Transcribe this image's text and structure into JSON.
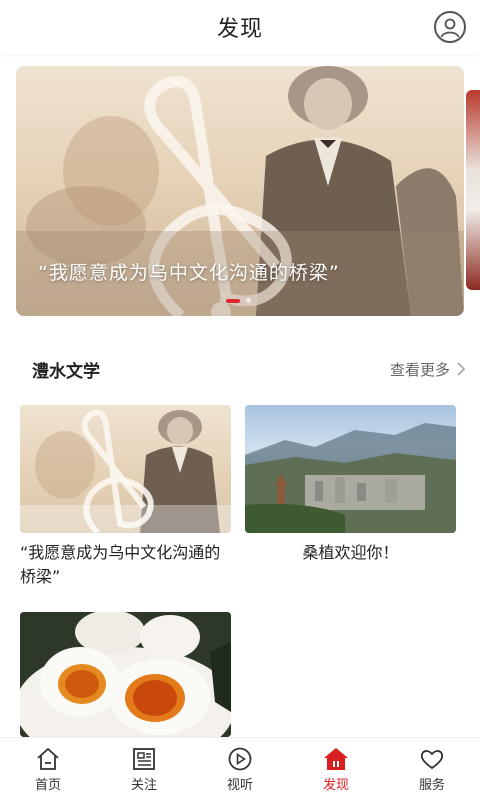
{
  "header": {
    "title": "发现"
  },
  "banner": {
    "caption": "“我愿意成为乌中文化沟通的桥梁”",
    "active_dot": 1,
    "dots": 2
  },
  "section": {
    "title": "澧水文学",
    "more_label": "查看更多"
  },
  "cards": [
    {
      "text": "“我愿意成为乌中文化沟通的桥梁”"
    },
    {
      "text": "桑植欢迎你！"
    }
  ],
  "nav": {
    "items": [
      {
        "label": "首页",
        "icon": "home-icon"
      },
      {
        "label": "关注",
        "icon": "news-icon"
      },
      {
        "label": "视听",
        "icon": "play-icon"
      },
      {
        "label": "发现",
        "icon": "discover-icon",
        "active": true
      },
      {
        "label": "服务",
        "icon": "heart-icon"
      }
    ]
  },
  "colors": {
    "accent": "#d81e1e",
    "banner_dot_active": "#e0262b"
  }
}
